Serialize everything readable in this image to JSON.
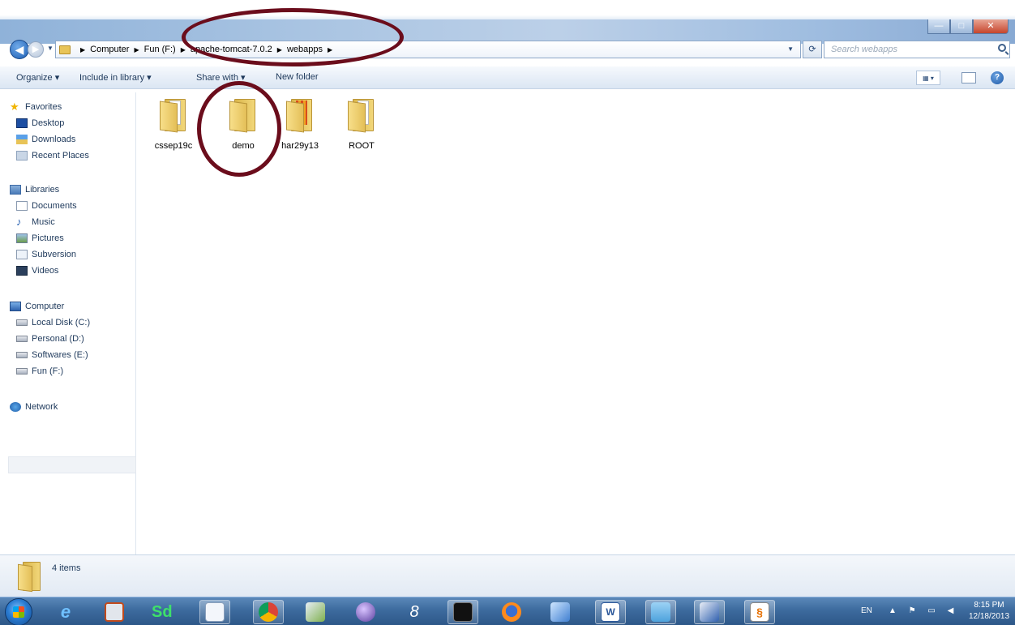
{
  "window": {
    "minimize_glyph": "—",
    "maximize_glyph": "□",
    "close_glyph": "✕"
  },
  "address_bar": {
    "breadcrumbs": [
      "Computer",
      "Fun (F:)",
      "apache-tomcat-7.0.2",
      "webapps"
    ],
    "search_placeholder": "Search webapps"
  },
  "toolbar": {
    "organize": "Organize ▾",
    "include_in_library": "Include in library ▾",
    "share_with": "Share with ▾",
    "new_folder": "New folder"
  },
  "nav_pane": {
    "favorites": {
      "label": "Favorites",
      "items": [
        "Desktop",
        "Downloads",
        "Recent Places"
      ]
    },
    "libraries": {
      "label": "Libraries",
      "items": [
        "Documents",
        "Music",
        "Pictures",
        "Subversion",
        "Videos"
      ]
    },
    "computer": {
      "label": "Computer",
      "items": [
        "Local Disk (C:)",
        "Personal (D:)",
        "Softwares (E:)",
        "Fun (F:)"
      ],
      "selected": "Fun (F:)"
    },
    "network": {
      "label": "Network"
    }
  },
  "files": [
    {
      "name": "cssep19c",
      "icon": "folder-icon"
    },
    {
      "name": "demo",
      "icon": "folder-icon"
    },
    {
      "name": "har29y13",
      "icon": "folder-icon"
    },
    {
      "name": "ROOT",
      "icon": "folder-icon"
    }
  ],
  "details_pane": {
    "count": "4 items"
  },
  "taskbar": {
    "apps": [
      "internet-explorer",
      "media-player",
      "sd-app",
      "notepad",
      "chrome",
      "paint",
      "app-orb",
      "app-8",
      "command-prompt",
      "firefox",
      "app-blue",
      "word",
      "app-window",
      "app-paint-blue",
      "java"
    ],
    "tray_language": "EN",
    "time": "8:15 PM",
    "date": "12/18/2013"
  },
  "colors": {
    "annotation": "#6b0d1c",
    "taskbar": "#3d6b9e",
    "toolbar_text": "#1e395b"
  }
}
